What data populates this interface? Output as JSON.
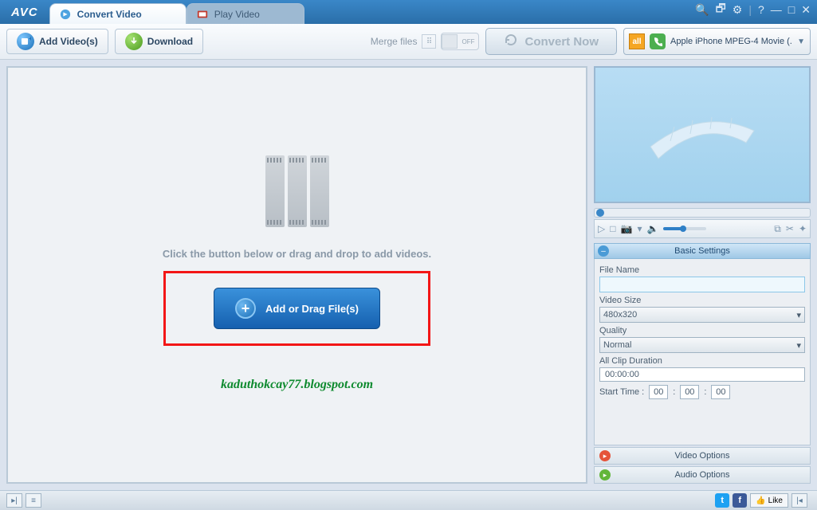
{
  "app": {
    "name": "AVC"
  },
  "tabs": {
    "convert": "Convert Video",
    "play": "Play Video"
  },
  "toolbar": {
    "add_videos": "Add Video(s)",
    "download": "Download",
    "merge_files": "Merge files",
    "merge_state": "OFF",
    "convert_now": "Convert Now",
    "profile_all": "all",
    "profile_text": "Apple iPhone MPEG-4 Movie (...",
    "profile_arrow": "▼"
  },
  "main": {
    "drop_hint": "Click the button below or drag and drop to add videos.",
    "add_drag": "Add or Drag File(s)",
    "watermark": "kaduthokcay77.blogspot.com"
  },
  "settings": {
    "header": "Basic Settings",
    "file_name_label": "File Name",
    "file_name_value": "",
    "video_size_label": "Video Size",
    "video_size_value": "480x320",
    "quality_label": "Quality",
    "quality_value": "Normal",
    "all_clip_label": "All Clip Duration",
    "all_clip_value": "00:00:00",
    "start_time_label": "Start Time :",
    "st_h": "00",
    "st_m": "00",
    "st_s": "00",
    "video_options": "Video Options",
    "audio_options": "Audio Options"
  },
  "statusbar": {
    "like": "Like"
  }
}
